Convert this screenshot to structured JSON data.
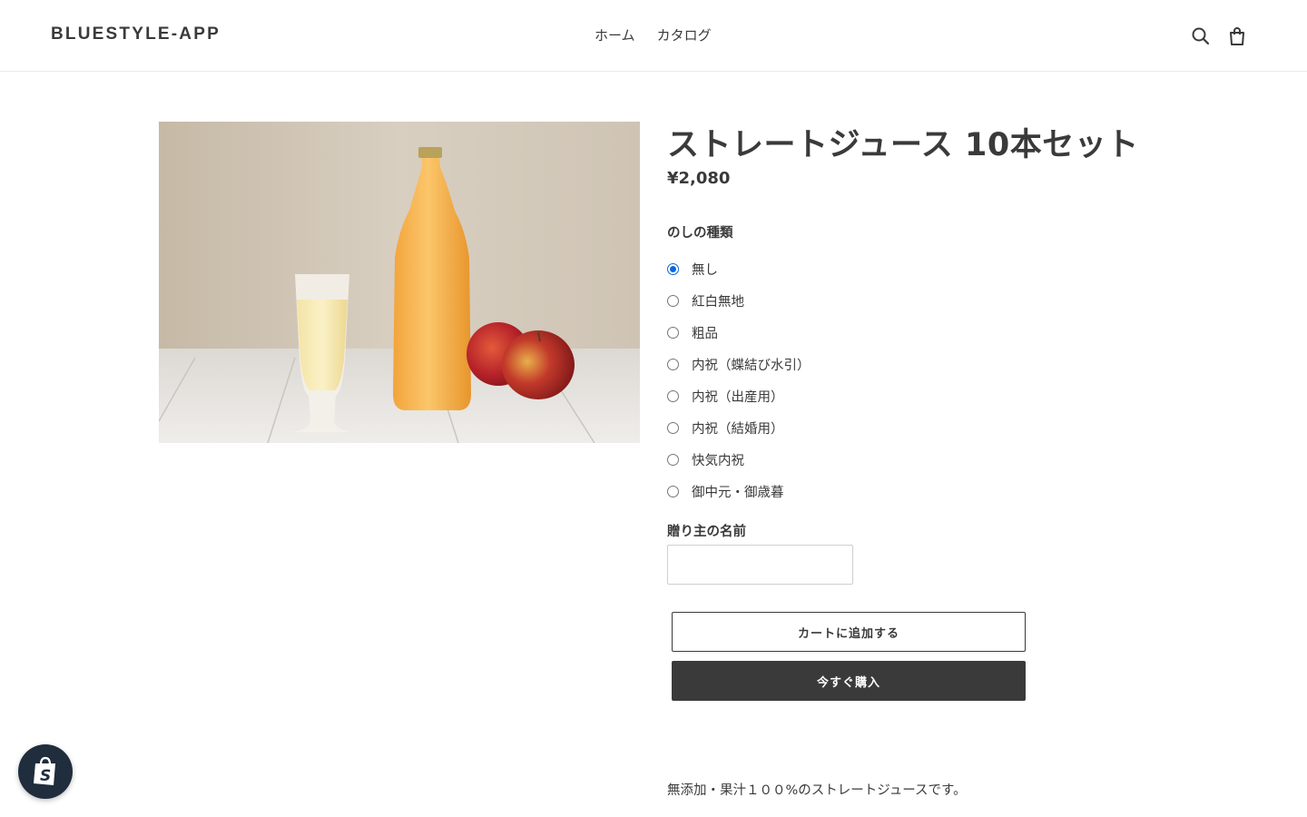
{
  "header": {
    "logo": "BLUESTYLE-APP",
    "nav": [
      {
        "label": "ホーム"
      },
      {
        "label": "カタログ"
      }
    ],
    "search_icon": "search-icon",
    "cart_icon": "cart-icon"
  },
  "product": {
    "image_icon": "product-photo-apple-juice",
    "title": "ストレートジュース 10本セット",
    "price": "¥2,080",
    "noshi": {
      "label": "のしの種類",
      "selected": "無し",
      "options": [
        {
          "label": "無し",
          "checked": true
        },
        {
          "label": "紅白無地",
          "checked": false
        },
        {
          "label": "粗品",
          "checked": false
        },
        {
          "label": "内祝（蝶結び水引）",
          "checked": false
        },
        {
          "label": "内祝（出産用）",
          "checked": false
        },
        {
          "label": "内祝（結婚用）",
          "checked": false
        },
        {
          "label": "快気内祝",
          "checked": false
        },
        {
          "label": "御中元・御歳暮",
          "checked": false
        }
      ]
    },
    "sender": {
      "label": "贈り主の名前",
      "value": "",
      "placeholder": ""
    },
    "add_to_cart_label": "カートに追加する",
    "buy_now_label": "今すぐ購入",
    "description": "無添加・果汁１００%のストレートジュースです。"
  },
  "shopify_badge_icon": "shopify-bag-icon",
  "colors": {
    "text": "#3a3a3a",
    "accent_radio": "#0a66e0",
    "buy_button_bg": "#3a3a3a",
    "badge_bg": "#1f2d3d"
  }
}
